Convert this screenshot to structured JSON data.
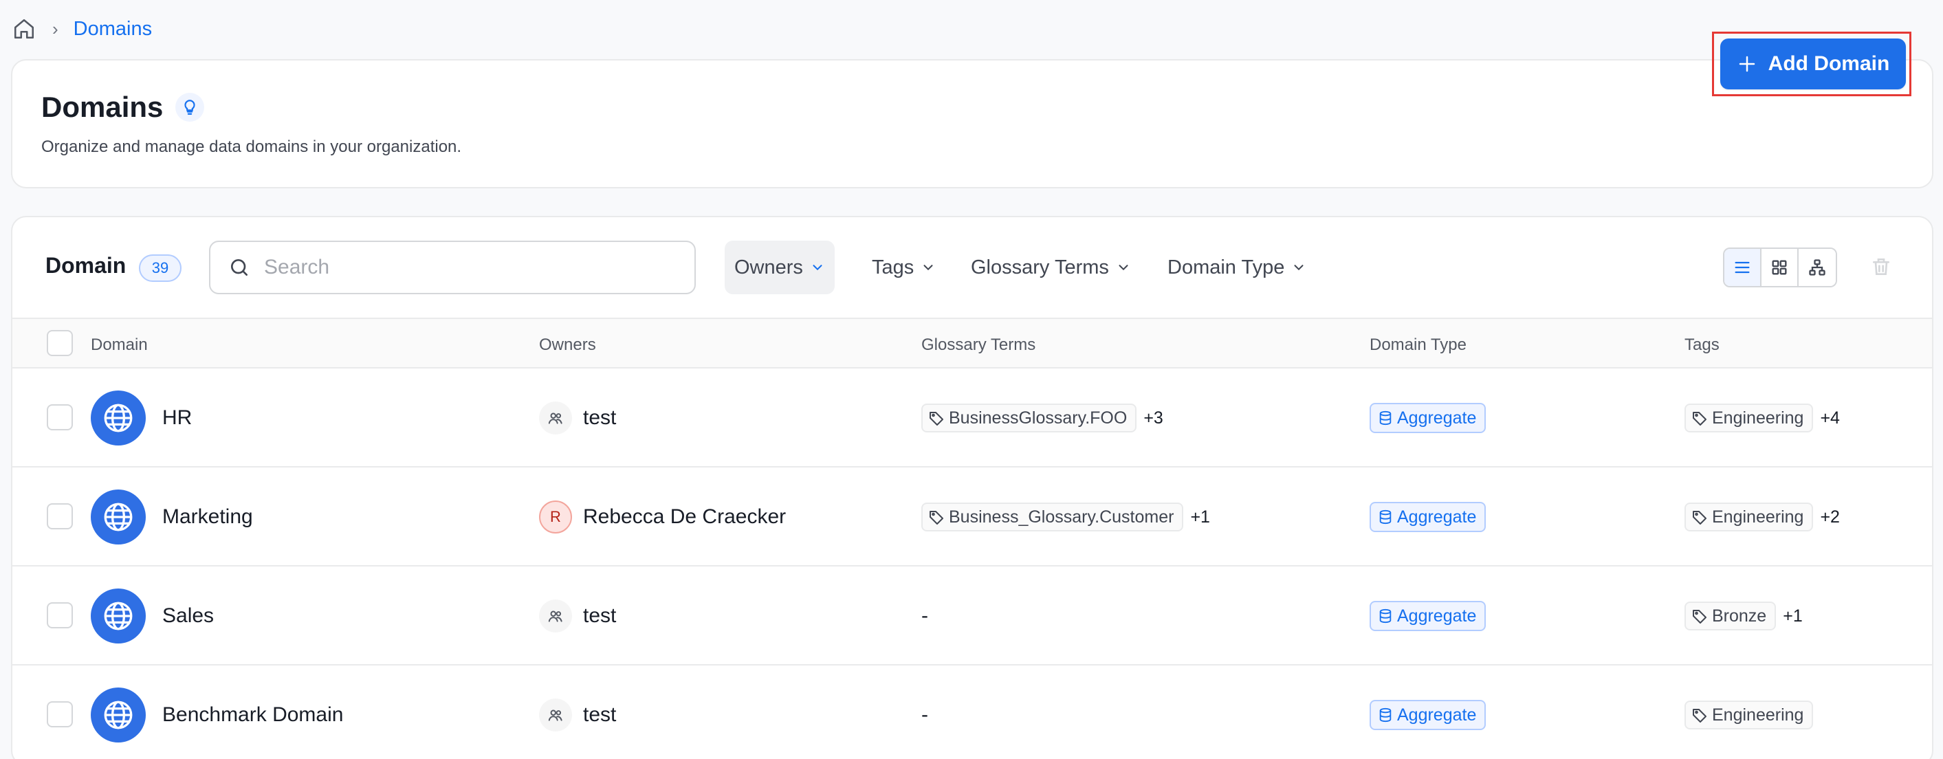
{
  "breadcrumb": {
    "current": "Domains"
  },
  "header": {
    "title": "Domains",
    "subtitle": "Organize and manage data domains in your organization.",
    "add_button_label": "Add Domain"
  },
  "toolbar": {
    "label": "Domain",
    "count": "39",
    "search_placeholder": "Search",
    "filters": [
      "Owners",
      "Tags",
      "Glossary Terms",
      "Domain Type"
    ],
    "active_filter": "Owners",
    "view_modes": [
      "list",
      "grid",
      "tree"
    ],
    "active_view": "list"
  },
  "table": {
    "columns": [
      "Domain",
      "Owners",
      "Glossary Terms",
      "Domain Type",
      "Tags"
    ],
    "rows": [
      {
        "name": "HR",
        "owner": "test",
        "owner_type": "team",
        "owner_initial": "",
        "glossary_term": "BusinessGlossary.FOO",
        "glossary_more": "+3",
        "domain_type": "Aggregate",
        "tag": "Engineering",
        "tag_more": "+4"
      },
      {
        "name": "Marketing",
        "owner": "Rebecca De Craecker",
        "owner_type": "user",
        "owner_initial": "R",
        "glossary_term": "Business_Glossary.Customer",
        "glossary_more": "+1",
        "domain_type": "Aggregate",
        "tag": "Engineering",
        "tag_more": "+2"
      },
      {
        "name": "Sales",
        "owner": "test",
        "owner_type": "team",
        "owner_initial": "",
        "glossary_term": "",
        "glossary_empty": "-",
        "glossary_more": "",
        "domain_type": "Aggregate",
        "tag": "Bronze",
        "tag_more": "+1"
      },
      {
        "name": "Benchmark Domain",
        "owner": "test",
        "owner_type": "team",
        "owner_initial": "",
        "glossary_term": "",
        "glossary_empty": "-",
        "glossary_more": "",
        "domain_type": "Aggregate",
        "tag": "Engineering",
        "tag_more": ""
      }
    ]
  },
  "colors": {
    "accent": "#1e6fe8",
    "link": "#1570ef",
    "highlight_border": "#e53935",
    "domain_icon_bg": "#2f6fe4"
  }
}
